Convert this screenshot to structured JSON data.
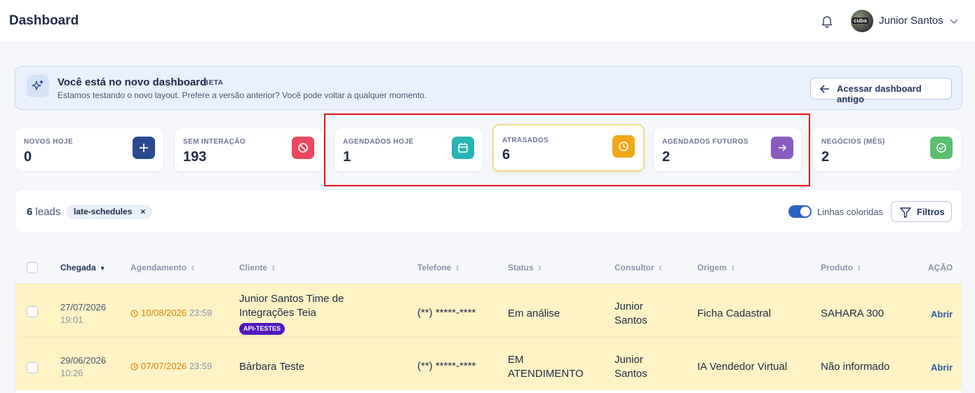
{
  "header": {
    "title": "Dashboard",
    "user_name": "Junior Santos",
    "avatar_text": "cuba"
  },
  "banner": {
    "heading": "Você está no novo dashboard",
    "badge": "BETA",
    "subtitle": "Estamos testando o novo layout. Prefere a versão anterior? Você pode voltar a qualquer momento.",
    "button_label": "Acessar dashboard antigo"
  },
  "cards": [
    {
      "label": "NOVOS HOJE",
      "value": "0",
      "icon": "plus-icon",
      "color": "#2b4a8f"
    },
    {
      "label": "SEM INTERAÇÃO",
      "value": "193",
      "icon": "ban-icon",
      "color": "#e9475f"
    },
    {
      "label": "AGENDADOS HOJE",
      "value": "1",
      "icon": "calendar-icon",
      "color": "#2ab3b5"
    },
    {
      "label": "ATRASADOS",
      "value": "6",
      "icon": "clock-icon",
      "color": "#f0a81a"
    },
    {
      "label": "AGENDADOS FUTUROS",
      "value": "2",
      "icon": "arrow-right-icon",
      "color": "#8a5bbf"
    },
    {
      "label": "NEGÓCIOS (MÊS)",
      "value": "2",
      "icon": "check-circle-icon",
      "color": "#5bbd6e"
    }
  ],
  "filterbar": {
    "count_number": "6",
    "count_label": "leads",
    "chip": "late-schedules",
    "chip_remove": "×",
    "toggle_label": "Linhas coloridas",
    "toggle_on": true,
    "filters_label": "Filtros"
  },
  "table": {
    "columns": [
      "Chegada",
      "Agendamento",
      "Cliente",
      "Telefone",
      "Status",
      "Consultor",
      "Origem",
      "Produto",
      "AÇÃO"
    ],
    "rows": [
      {
        "arrival_date": "27/07/2026",
        "arrival_time": "19:01",
        "schedule_date": "10/08/2026",
        "schedule_time": "23:59",
        "client_line1": "Junior Santos Time de",
        "client_line2": "Integrações Teia",
        "tag": "API-TESTES",
        "phone": "(**) *****-****",
        "status_line1": "Em análise",
        "status_line2": "",
        "consultant_line1": "Junior",
        "consultant_line2": "Santos",
        "origin": "Ficha Cadastral",
        "product": "SAHARA 300",
        "action": "Abrir"
      },
      {
        "arrival_date": "29/06/2026",
        "arrival_time": "10:26",
        "schedule_date": "07/07/2026",
        "schedule_time": "23:59",
        "client_line1": "Bárbara Teste",
        "client_line2": "",
        "tag": "",
        "phone": "(**) *****-****",
        "status_line1": "EM",
        "status_line2": "ATENDIMENTO",
        "consultant_line1": "Junior",
        "consultant_line2": "Santos",
        "origin": "IA Vendedor Virtual",
        "product": "Não informado",
        "action": "Abrir"
      }
    ]
  }
}
